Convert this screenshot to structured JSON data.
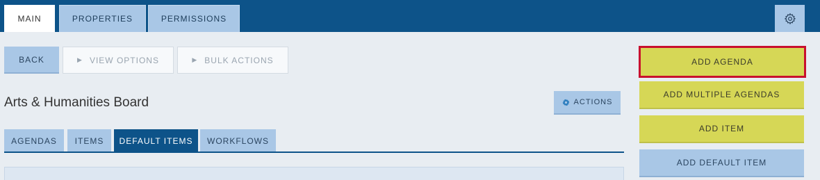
{
  "top_tabs": [
    {
      "label": "MAIN",
      "active": true
    },
    {
      "label": "PROPERTIES",
      "active": false
    },
    {
      "label": "PERMISSIONS",
      "active": false
    }
  ],
  "settings_icon": "gear-icon",
  "toolbar": {
    "back_label": "BACK",
    "view_options_label": "VIEW OPTIONS",
    "bulk_actions_label": "BULK ACTIONS",
    "expand_icon": "triangle-right-icon"
  },
  "page_title": "Arts & Humanities Board",
  "actions": {
    "label": "ACTIONS",
    "icon": "gear-small-icon"
  },
  "sub_tabs": [
    {
      "label": "AGENDAS",
      "active": false
    },
    {
      "label": "ITEMS",
      "active": false
    },
    {
      "label": "DEFAULT ITEMS",
      "active": true
    },
    {
      "label": "WORKFLOWS",
      "active": false
    }
  ],
  "side_buttons": {
    "add_agenda": "ADD AGENDA",
    "add_multiple_agendas": "ADD MULTIPLE AGENDAS",
    "add_item": "ADD ITEM",
    "add_default_item": "ADD DEFAULT ITEM"
  },
  "colors": {
    "header_bg": "#0d5389",
    "tab_bg": "#a9c7e6",
    "accent_yellow": "#d6d756",
    "selection_red": "#c8102e",
    "page_bg": "#e8edf2"
  }
}
